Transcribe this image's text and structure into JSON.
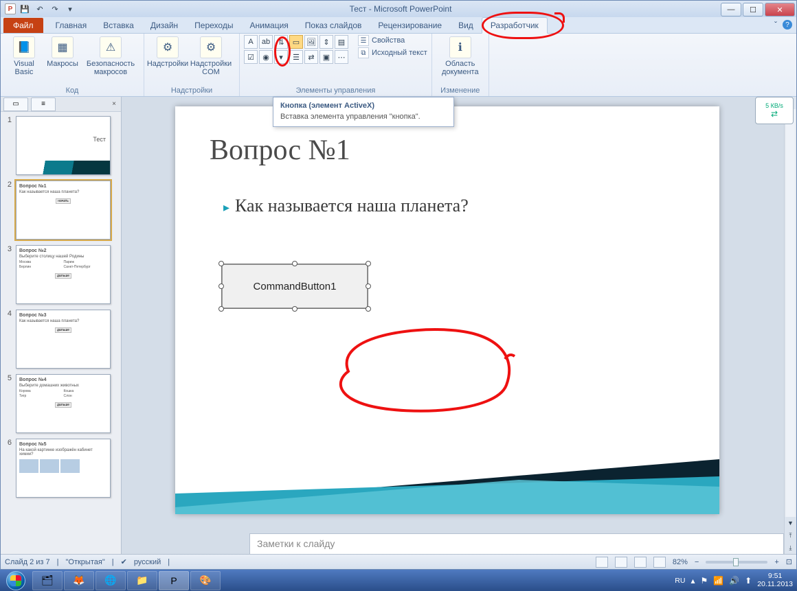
{
  "window": {
    "title": "Тест - Microsoft PowerPoint",
    "qat_app_letter": "P"
  },
  "tabs": {
    "file": "Файл",
    "items": [
      "Главная",
      "Вставка",
      "Дизайн",
      "Переходы",
      "Анимация",
      "Показ слайдов",
      "Рецензирование",
      "Вид",
      "Разработчик"
    ],
    "active_index": 8
  },
  "ribbon": {
    "group_code": {
      "label": "Код",
      "visual_basic": "Visual\nBasic",
      "macros": "Макросы",
      "macro_security": "Безопасность\nмакросов"
    },
    "group_addins": {
      "label": "Надстройки",
      "addins": "Надстройки",
      "com_addins": "Надстройки\nCOM"
    },
    "group_controls": {
      "label": "Элементы управления",
      "properties": "Свойства",
      "view_code": "Исходный текст"
    },
    "group_change": {
      "label": "Изменение",
      "doc_panel": "Область\nдокумента"
    }
  },
  "tooltip": {
    "title": "Кнопка (элемент ActiveX)",
    "body": "Вставка элемента управления \"кнопка\"."
  },
  "thumbnails": [
    {
      "n": "1",
      "title": "Тест",
      "selected": false,
      "type": "title"
    },
    {
      "n": "2",
      "title": "Вопрос №1",
      "line": "Как называется наша планета?",
      "btn": "начать",
      "selected": true
    },
    {
      "n": "3",
      "title": "Вопрос №2",
      "line": "Выберите столицу нашей Родины",
      "opts": [
        "Москва",
        "Париж",
        "Берлин",
        "Санкт-Петербург"
      ],
      "btn": "дальше",
      "selected": false
    },
    {
      "n": "4",
      "title": "Вопрос №3",
      "line": "Как называется наша планета?",
      "btn": "дальше",
      "selected": false
    },
    {
      "n": "5",
      "title": "Вопрос №4",
      "line": "Выберите домашних животных",
      "opts": [
        "Корова",
        "Кошка",
        "Тигр",
        "Слон"
      ],
      "btn": "дальше",
      "selected": false
    },
    {
      "n": "6",
      "title": "Вопрос №5",
      "line": "На какой картинке изображён кабинет химии?",
      "type": "images",
      "selected": false
    }
  ],
  "slide": {
    "title": "Вопрос №1",
    "body": "Как называется наша планета?",
    "button_label": "CommandButton1"
  },
  "notes_placeholder": "Заметки к слайду",
  "status": {
    "slide_info": "Слайд 2 из 7",
    "theme": "\"Открытая\"",
    "language": "русский",
    "zoom": "82%"
  },
  "gadget": {
    "speed": "5 КВ/s"
  },
  "tray": {
    "lang": "RU",
    "time": "9:51",
    "date": "20.11.2013"
  }
}
